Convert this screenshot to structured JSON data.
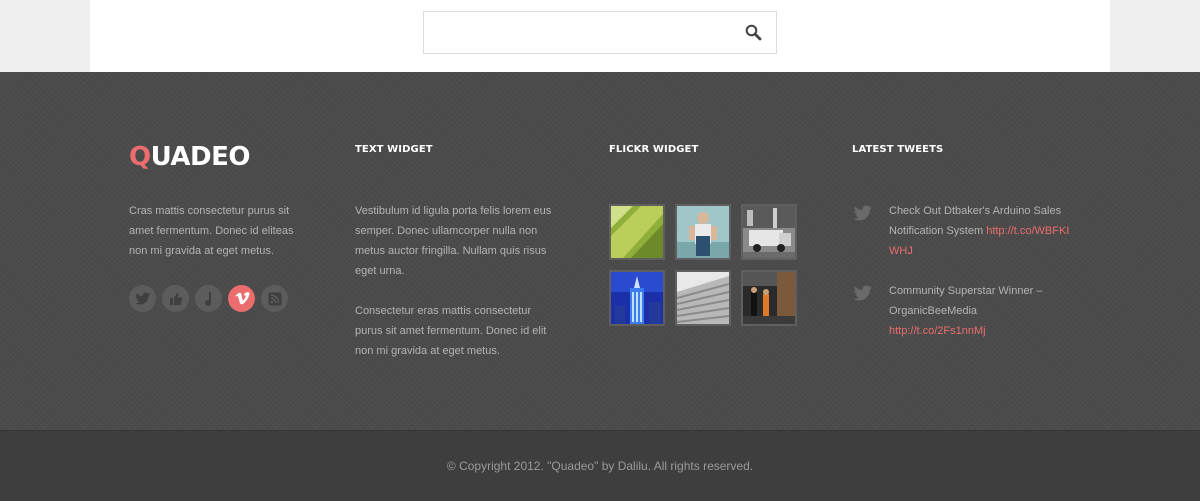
{
  "search": {
    "placeholder": "",
    "value": "",
    "icon": "search-icon"
  },
  "footer": {
    "brand": {
      "logo_first_letter": "Q",
      "logo_rest": "UADEO",
      "description": "Cras mattis consectetur purus sit amet fermentum. Donec id eliteas non mi gravida at eget metus.",
      "social_icons": [
        "twitter-icon",
        "like-icon",
        "music-icon",
        "vimeo-icon",
        "rss-icon"
      ],
      "active_social": "vimeo-icon"
    },
    "text_widget": {
      "title": "TEXT WIDGET",
      "paragraphs": [
        "Vestibulum id ligula porta felis lorem eus semper. Donec ullamcorper nulla non metus auctor fringilla. Nullam quis risus eget urna.",
        "Consectetur eras mattis consectetur purus sit amet fermentum. Donec id elit non mi gravida at eget metus."
      ]
    },
    "flickr_widget": {
      "title": "FLICKR WIDGET",
      "photos": [
        "green-abstract-photo",
        "person-portrait-photo",
        "street-truck-photo",
        "city-tower-photo",
        "roof-lines-photo",
        "street-people-photo"
      ]
    },
    "latest_tweets": {
      "title": "LATEST TWEETS",
      "tweets": [
        {
          "text": "Check Out Dtbaker's Arduino Sales Notification System ",
          "link": "http://t.co/WBFKIWHJ"
        },
        {
          "text": "Community Superstar Winner – OrganicBeeMedia ",
          "link": "http://t.co/2Fs1nnMj"
        }
      ]
    },
    "copyright": "© Copyright 2012. \"Quadeo\" by Dalilu. All rights reserved."
  },
  "colors": {
    "accent": "#ec6d6d",
    "footer_bg": "#4b4b4b",
    "footer_bottom_bg": "#3e3e3e",
    "text_muted": "#b4b4b4"
  }
}
